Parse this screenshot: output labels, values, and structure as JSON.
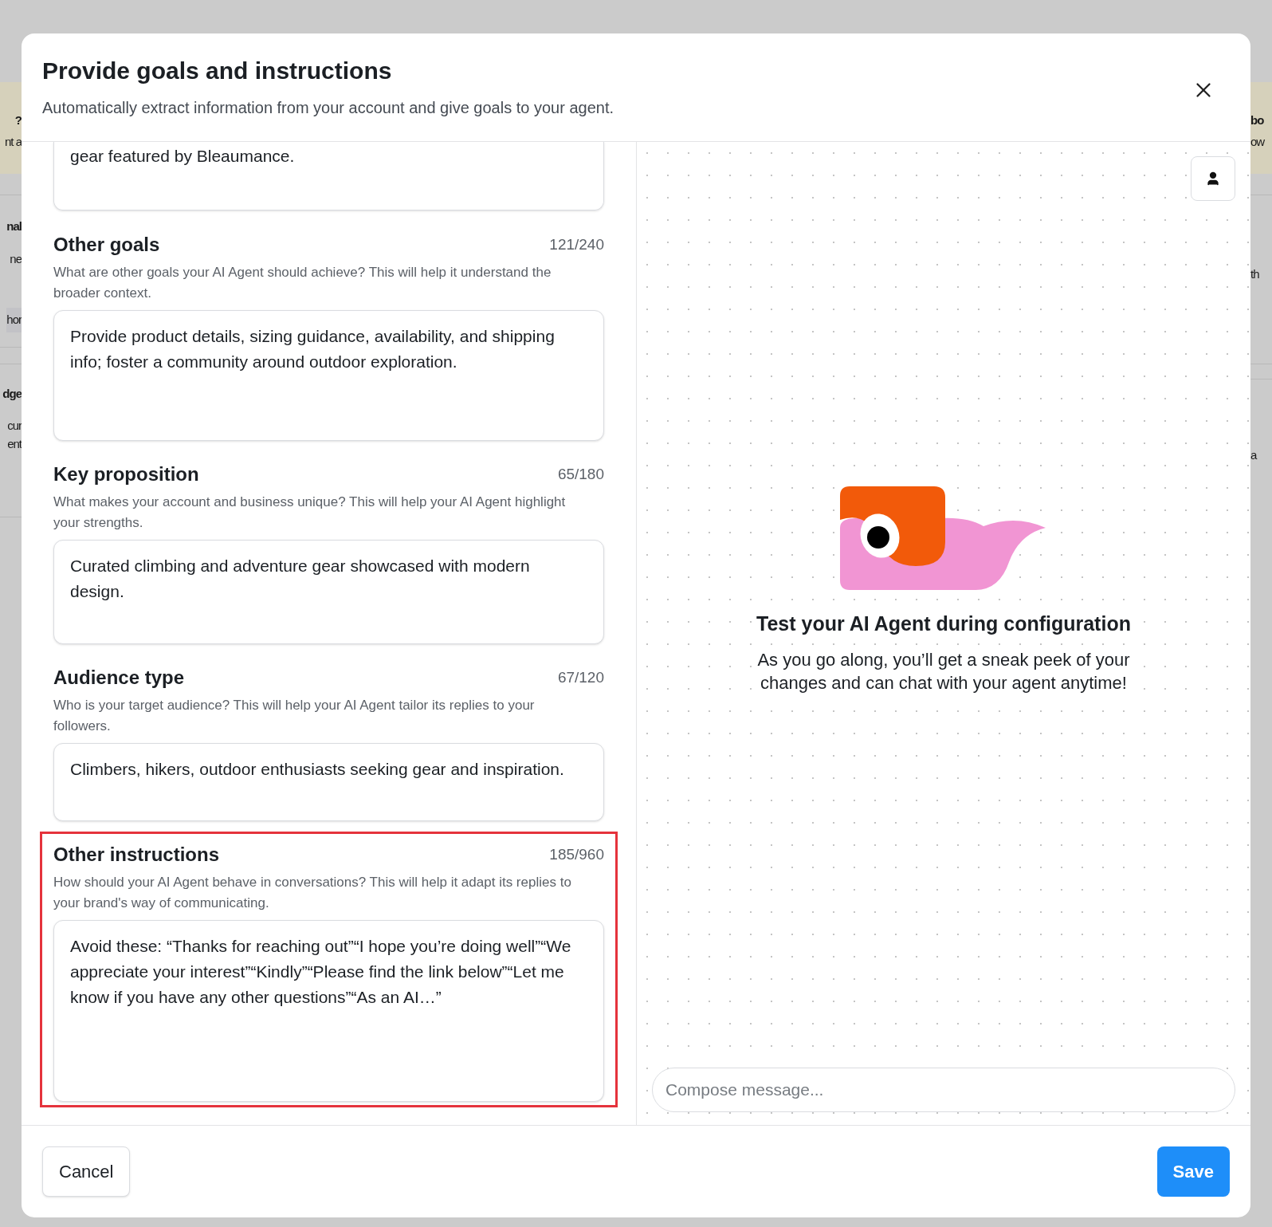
{
  "background_page": {
    "left_fragments": [
      {
        "text": "?",
        "kind": "heading"
      },
      {
        "text": "nt a",
        "kind": "text"
      },
      {
        "text": "nal",
        "kind": "heading"
      },
      {
        "text": "ne",
        "kind": "text"
      },
      {
        "text": "hor",
        "kind": "chip"
      },
      {
        "text": "dge",
        "kind": "heading"
      },
      {
        "text": "cur",
        "kind": "text"
      },
      {
        "text": "ent",
        "kind": "text"
      }
    ],
    "right_fragments": [
      {
        "text": "bo",
        "kind": "heading"
      },
      {
        "text": "ow",
        "kind": "text"
      },
      {
        "text": "th",
        "kind": "text"
      },
      {
        "text": "a",
        "kind": "text"
      }
    ]
  },
  "dialog": {
    "title": "Provide goals and instructions",
    "subtitle": "Automatically extract information from your account and give goals to your agent.",
    "top_field_value": "gear featured by Bleaumance.",
    "sections": [
      {
        "title": "Other goals",
        "count": "121/240",
        "description": "What are other goals your AI Agent should achieve? This will help it understand the broader context.",
        "value": "Provide product details, sizing guidance, availability, and shipping info; foster a community around outdoor exploration.",
        "highlighted": false
      },
      {
        "title": "Key proposition",
        "count": "65/180",
        "description": "What makes your account and business unique? This will help your AI Agent highlight your strengths.",
        "value": "Curated climbing and adventure gear showcased with modern design.",
        "highlighted": false
      },
      {
        "title": "Audience type",
        "count": "67/120",
        "description": "Who is your target audience? This will help your AI Agent tailor its replies to your followers.",
        "value": "Climbers, hikers, outdoor enthusiasts seeking gear and inspiration.",
        "highlighted": false
      },
      {
        "title": "Other instructions",
        "count": "185/960",
        "description": "How should your AI Agent behave in conversations? This will help it adapt its replies to your brand's way of communicating.",
        "value": "Avoid these: “Thanks for reaching out”“I hope you’re doing well”“We appreciate your interest”“Kindly”“Please find the link below”“Let me know if you have any other questions”“As an AI…”",
        "highlighted": true
      }
    ],
    "preview": {
      "title": "Test your AI Agent during configuration",
      "text": "As you go along, you’ll get a sneak peek of your changes and can chat with your agent anytime!",
      "compose_placeholder": "Compose message..."
    },
    "buttons": {
      "cancel": "Cancel",
      "save": "Save"
    }
  }
}
